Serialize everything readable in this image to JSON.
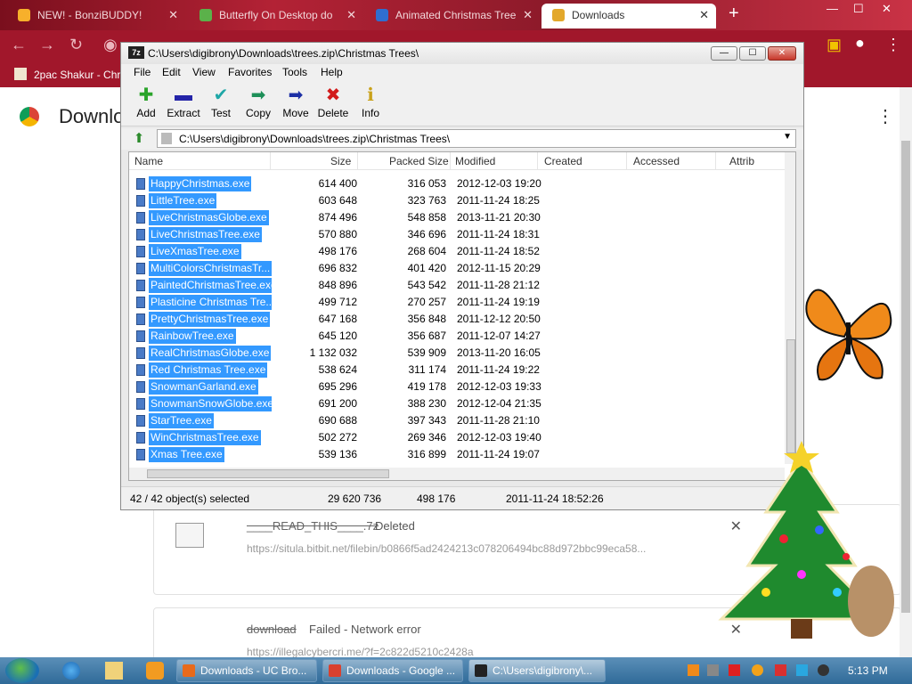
{
  "chrome": {
    "tabs": [
      {
        "label": "NEW! - BonziBUDDY!",
        "fav": "#f7b02b"
      },
      {
        "label": "Butterfly On Desktop do",
        "fav": "#5bb14a"
      },
      {
        "label": "Animated Christmas Tree",
        "fav": "#2f6ed0"
      },
      {
        "label": "Downloads",
        "fav": "#e3a82b"
      }
    ],
    "new_tab": "+",
    "bookmark_label": "2pac Shakur - Chro"
  },
  "downloads_page": {
    "title": "Downlo",
    "menu_icon": "⋮",
    "items": [
      {
        "filename": "____READ_THIS____.7z",
        "status": "Deleted",
        "url": "https://situla.bitbit.net/filebin/b0866f5ad2424213c078206494bc88d972bbc99eca58..."
      },
      {
        "filename": "download",
        "status": "Failed - Network error",
        "url": "https://illegalcybercri.me/?f=2c822d5210c2428a"
      }
    ]
  },
  "zip": {
    "title": "C:\\Users\\digibrony\\Downloads\\trees.zip\\Christmas Trees\\",
    "logo": "7z",
    "window_buttons": {
      "min": "—",
      "max": "☐",
      "close": "✕"
    },
    "menu": [
      "File",
      "Edit",
      "View",
      "Favorites",
      "Tools",
      "Help"
    ],
    "toolbar": [
      {
        "label": "Add",
        "icon": "plus-icon",
        "glyph": "✚",
        "color": "#2aa42a"
      },
      {
        "label": "Extract",
        "icon": "minus-icon",
        "glyph": "▬",
        "color": "#2424a8"
      },
      {
        "label": "Test",
        "icon": "check-icon",
        "glyph": "✔",
        "color": "#1fa7a7"
      },
      {
        "label": "Copy",
        "icon": "copy-arrow-icon",
        "glyph": "➡",
        "color": "#1d8f58"
      },
      {
        "label": "Move",
        "icon": "move-arrow-icon",
        "glyph": "➡",
        "color": "#1c2fa5"
      },
      {
        "label": "Delete",
        "icon": "delete-x-icon",
        "glyph": "✖",
        "color": "#d21b1b"
      },
      {
        "label": "Info",
        "icon": "info-icon",
        "glyph": "ℹ",
        "color": "#c9a21b"
      }
    ],
    "address": "C:\\Users\\digibrony\\Downloads\\trees.zip\\Christmas Trees\\",
    "columns": [
      "Name",
      "Size",
      "Packed Size",
      "Modified",
      "Created",
      "Accessed",
      "Attrib"
    ],
    "files": [
      {
        "name": "HappyChristmas.exe",
        "size": "614 400",
        "packed": "316 053",
        "modified": "2012-12-03 19:20"
      },
      {
        "name": "LittleTree.exe",
        "size": "603 648",
        "packed": "323 763",
        "modified": "2011-11-24 18:25"
      },
      {
        "name": "LiveChristmasGlobe.exe",
        "size": "874 496",
        "packed": "548 858",
        "modified": "2013-11-21 20:30"
      },
      {
        "name": "LiveChristmasTree.exe",
        "size": "570 880",
        "packed": "346 696",
        "modified": "2011-11-24 18:31"
      },
      {
        "name": "LiveXmasTree.exe",
        "size": "498 176",
        "packed": "268 604",
        "modified": "2011-11-24 18:52"
      },
      {
        "name": "MultiColorsChristmasTr...",
        "size": "696 832",
        "packed": "401 420",
        "modified": "2012-11-15 20:29"
      },
      {
        "name": "PaintedChristmasTree.exe",
        "size": "848 896",
        "packed": "543 542",
        "modified": "2011-11-28 21:12"
      },
      {
        "name": "Plasticine Christmas Tre...",
        "size": "499 712",
        "packed": "270 257",
        "modified": "2011-11-24 19:19"
      },
      {
        "name": "PrettyChristmasTree.exe",
        "size": "647 168",
        "packed": "356 848",
        "modified": "2011-12-12 20:50"
      },
      {
        "name": "RainbowTree.exe",
        "size": "645 120",
        "packed": "356 687",
        "modified": "2011-12-07 14:27"
      },
      {
        "name": "RealChristmasGlobe.exe",
        "size": "1 132 032",
        "packed": "539 909",
        "modified": "2013-11-20 16:05"
      },
      {
        "name": "Red Christmas Tree.exe",
        "size": "538 624",
        "packed": "311 174",
        "modified": "2011-11-24 19:22"
      },
      {
        "name": "SnowmanGarland.exe",
        "size": "695 296",
        "packed": "419 178",
        "modified": "2012-12-03 19:33"
      },
      {
        "name": "SnowmanSnowGlobe.exe",
        "size": "691 200",
        "packed": "388 230",
        "modified": "2012-12-04 21:35"
      },
      {
        "name": "StarTree.exe",
        "size": "690 688",
        "packed": "397 343",
        "modified": "2011-11-28 21:10"
      },
      {
        "name": "WinChristmasTree.exe",
        "size": "502 272",
        "packed": "269 346",
        "modified": "2012-12-03 19:40"
      },
      {
        "name": "Xmas Tree.exe",
        "size": "539 136",
        "packed": "316 899",
        "modified": "2011-11-24 19:07"
      }
    ],
    "status": {
      "selected": "42 / 42 object(s) selected",
      "total_size": "29 620 736",
      "focused_size": "498 176",
      "focused_modified": "2011-11-24 18:52:26"
    }
  },
  "taskbar": {
    "tasks": [
      {
        "label": "Downloads - UC Bro...",
        "fav": "#e86a1b"
      },
      {
        "label": "Downloads - Google ...",
        "fav": "#d9412f"
      },
      {
        "label": "C:\\Users\\digibrony\\...",
        "fav": "#222"
      }
    ],
    "time": "5:13 PM"
  },
  "colors": {
    "selection": "#3399ff",
    "chrome_frame": "#a1172b"
  }
}
